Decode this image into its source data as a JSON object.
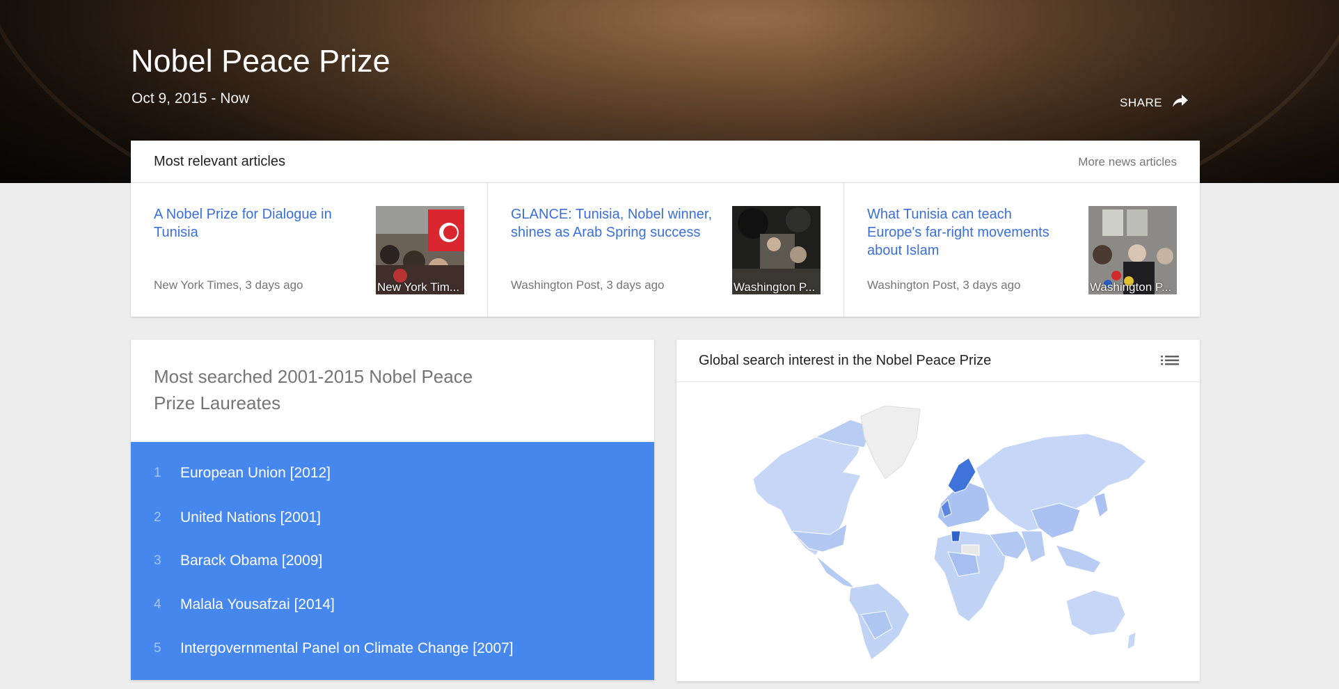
{
  "hero": {
    "title": "Nobel Peace Prize",
    "date_range": "Oct 9, 2015 - Now",
    "share_label": "SHARE"
  },
  "articles": {
    "header": "Most relevant articles",
    "more_label": "More news articles",
    "items": [
      {
        "title": "A Nobel Prize for Dialogue in Tunisia",
        "source": "New York Times, 3 days ago",
        "thumb_caption": "New York Tim..."
      },
      {
        "title": "GLANCE: Tunisia, Nobel winner, shines as Arab Spring success",
        "source": "Washington Post, 3 days ago",
        "thumb_caption": "Washington P..."
      },
      {
        "title": "What Tunisia can teach Europe's far-right movements about Islam",
        "source": "Washington Post, 3 days ago",
        "thumb_caption": "Washington P..."
      }
    ]
  },
  "laureates": {
    "title": "Most searched 2001-2015 Nobel Peace Prize Laureates",
    "items": [
      {
        "rank": "1",
        "name": "European Union [2012]"
      },
      {
        "rank": "2",
        "name": "United Nations [2001]"
      },
      {
        "rank": "3",
        "name": "Barack Obama [2009]"
      },
      {
        "rank": "4",
        "name": "Malala Yousafzai [2014]"
      },
      {
        "rank": "5",
        "name": "Intergovernmental Panel on Climate Change [2007]"
      }
    ],
    "accent_color": "#4687ee"
  },
  "map": {
    "title": "Global search interest in the Nobel Peace Prize",
    "menu_icon": "list-icon",
    "colors": {
      "low": "#c5d6f6",
      "mid": "#8fb0ee",
      "high": "#3f73dc",
      "none": "#eeeeee"
    }
  },
  "icons": {
    "share": "share-arrow-icon"
  }
}
